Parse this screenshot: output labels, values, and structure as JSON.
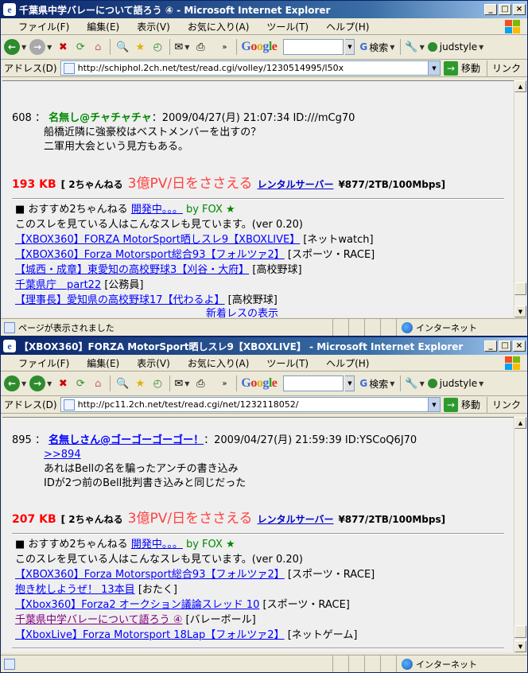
{
  "windows": [
    {
      "title": "千葉県中学バレーについて語ろう ④ - Microsoft Internet Explorer",
      "menu": [
        "ファイル(F)",
        "編集(E)",
        "表示(V)",
        "お気に入り(A)",
        "ツール(T)",
        "ヘルプ(H)"
      ],
      "toolbar": {
        "google": "Google",
        "search_label": "検索",
        "judstyle": "judstyle"
      },
      "address": {
        "label": "アドレス(D)",
        "url": "http://schiphol.2ch.net/test/read.cgi/volley/1230514995/l50x",
        "go": "移動",
        "links": "リンク"
      },
      "post": {
        "number": "608",
        "sep": "：",
        "name": "名無し@チャチャチャ",
        "meta": "：2009/04/27(月) 21:07:34 ID:///mCg70",
        "lines": [
          "船橋近隣に強豪校はベストメンバーを出すの？",
          "二軍用大会という見方もある。"
        ]
      },
      "ad": {
        "size": "193 KB",
        "nch": "[ 2ちゃんねる",
        "pv": "3億PV/日をささえる",
        "rental": "レンタルサーバー",
        "price": "¥877/2TB/100Mbps]"
      },
      "rec": {
        "prefix": "■ おすすめ2ちゃんねる",
        "dev": "開発中。。。",
        "by": "by FOX",
        "star": "★",
        "note": "このスレを見ている人はこんなスレも見ています。(ver 0.20)",
        "items": [
          {
            "link": "【XBOX360】FORZA MotorSport晒しスレ9【XBOXLIVE】",
            "cat": " [ネットwatch]"
          },
          {
            "link": "【XBOX360】Forza Motorsport総合93【フォルツァ2】",
            "cat": " [スポーツ・RACE]"
          },
          {
            "link": "【城西・成章】東愛知の高校野球3【刈谷・大府】",
            "cat": " [高校野球]"
          },
          {
            "link": "千葉県庁　part22",
            "cat": " [公務員]"
          },
          {
            "link": "【理事長】愛知県の高校野球17【代わるよ】",
            "cat": " [高校野球]"
          }
        ],
        "partial": "新着レスの表示"
      },
      "status": {
        "text": "ページが表示されました",
        "zone": "インターネット"
      }
    },
    {
      "title": "【XBOX360】FORZA MotorSport晒しスレ9【XBOXLIVE】 - Microsoft Internet Explorer",
      "menu": [
        "ファイル(F)",
        "編集(E)",
        "表示(V)",
        "お気に入り(A)",
        "ツール(T)",
        "ヘルプ(H)"
      ],
      "toolbar": {
        "google": "Google",
        "search_label": "検索",
        "judstyle": "judstyle"
      },
      "address": {
        "label": "アドレス(D)",
        "url": "http://pc11.2ch.net/test/read.cgi/net/1232118052/",
        "go": "移動",
        "links": "リンク"
      },
      "post": {
        "number": "895",
        "sep": "：",
        "name": "名無しさん@ゴーゴーゴーゴー！",
        "meta": "：2009/04/27(月) 21:59:39 ID:YSCoQ6J70",
        "anchor": ">>894",
        "lines": [
          "あれはBellの名を騙ったアンチの書き込み",
          "IDが2つ前のBell批判書き込みと同じだった"
        ]
      },
      "ad": {
        "size": "207 KB",
        "nch": "[ 2ちゃんねる",
        "pv": "3億PV/日をささえる",
        "rental": "レンタルサーバー",
        "price": "¥877/2TB/100Mbps]"
      },
      "rec": {
        "prefix": "■ おすすめ2ちゃんねる",
        "dev": "開発中。。。",
        "by": "by FOX",
        "star": "★",
        "note": "このスレを見ている人はこんなスレも見ています。(ver 0.20)",
        "items": [
          {
            "link": "【XBOX360】Forza Motorsport総合93【フォルツァ2】",
            "cat": " [スポーツ・RACE]"
          },
          {
            "link": "抱き枕しようぜ！ 13本目",
            "cat": " [おたく]"
          },
          {
            "link": "【Xbox360】Forza2 オークション議論スレッド 10",
            "cat": " [スポーツ・RACE]"
          },
          {
            "link": "千葉県中学バレーについて語ろう ④",
            "cat": " [バレーボール]"
          },
          {
            "link": "【XboxLive】Forza Motorsport 18Lap【フォルツァ2】",
            "cat": " [ネットゲーム]"
          }
        ]
      },
      "status": {
        "text": "",
        "zone": "インターネット"
      }
    }
  ]
}
